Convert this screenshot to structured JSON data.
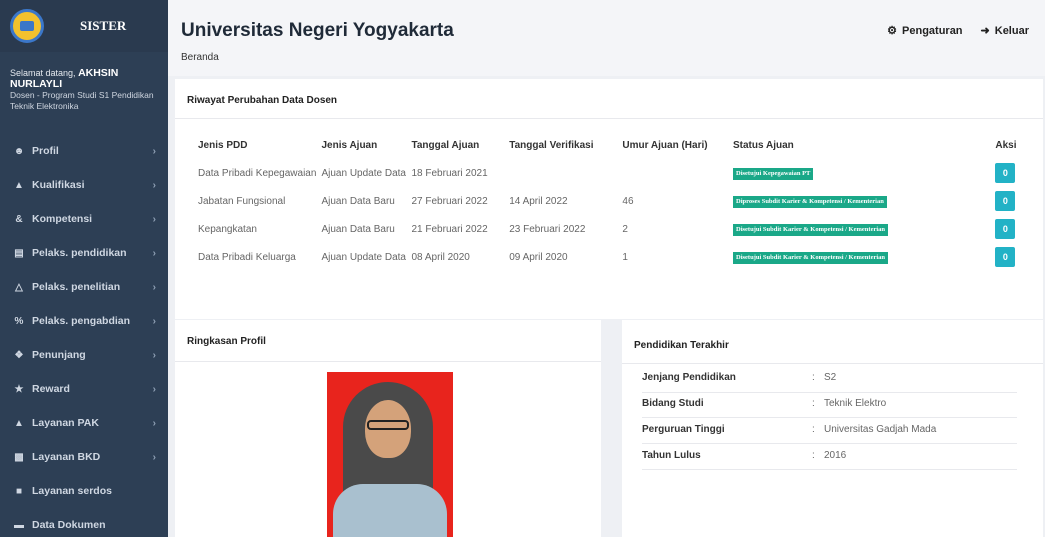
{
  "sidebar": {
    "brand": "SISTER",
    "welcome_prefix": "Selamat datang,",
    "user_name": "AKHSIN NURLAYLI",
    "user_role": "Dosen - Program Studi S1 Pendidikan Teknik Elektronika",
    "items": [
      {
        "label": "Profil",
        "icon": "user-icon"
      },
      {
        "label": "Kualifikasi",
        "icon": "graduation-cap-icon"
      },
      {
        "label": "Kompetensi",
        "icon": "link-icon"
      },
      {
        "label": "Pelaks. pendidikan",
        "icon": "book-icon"
      },
      {
        "label": "Pelaks. penelitian",
        "icon": "flask-icon"
      },
      {
        "label": "Pelaks. pengabdian",
        "icon": "percent-icon"
      },
      {
        "label": "Penunjang",
        "icon": "gift-icon"
      },
      {
        "label": "Reward",
        "icon": "trophy-icon"
      },
      {
        "label": "Layanan PAK",
        "icon": "graduation-cap-icon"
      },
      {
        "label": "Layanan BKD",
        "icon": "briefcase-icon"
      },
      {
        "label": "Layanan serdos",
        "icon": "book-icon"
      },
      {
        "label": "Data Dokumen",
        "icon": "folder-icon"
      }
    ]
  },
  "header": {
    "title": "Universitas Negeri Yogyakarta",
    "breadcrumb": "Beranda",
    "settings_label": "Pengaturan",
    "logout_label": "Keluar"
  },
  "riwayat": {
    "title": "Riwayat Perubahan Data Dosen",
    "columns": [
      "Jenis PDD",
      "Jenis Ajuan",
      "Tanggal Ajuan",
      "Tanggal Verifikasi",
      "Umur Ajuan (Hari)",
      "Status Ajuan",
      "Aksi"
    ],
    "rows": [
      {
        "jenis_pdd": "Data Pribadi Kepegawaian",
        "jenis_ajuan": "Ajuan Update Data",
        "tgl_ajuan": "18 Februari 2021",
        "tgl_verif": "",
        "umur": "",
        "status": "Disetujui Kepegawaian PT",
        "aksi": "0"
      },
      {
        "jenis_pdd": "Jabatan Fungsional",
        "jenis_ajuan": "Ajuan Data Baru",
        "tgl_ajuan": "27 Februari 2022",
        "tgl_verif": "14 April 2022",
        "umur": "46",
        "status": "Diproses Subdit Karier & Kompetensi / Kementerian",
        "aksi": "0"
      },
      {
        "jenis_pdd": "Kepangkatan",
        "jenis_ajuan": "Ajuan Data Baru",
        "tgl_ajuan": "21 Februari 2022",
        "tgl_verif": "23 Februari 2022",
        "umur": "2",
        "status": "Disetujui Subdit Karier & Kompetensi / Kementerian",
        "aksi": "0"
      },
      {
        "jenis_pdd": "Data Pribadi Keluarga",
        "jenis_ajuan": "Ajuan Update Data",
        "tgl_ajuan": "08 April 2020",
        "tgl_verif": "09 April 2020",
        "umur": "1",
        "status": "Disetujui Subdit Karier & Kompetensi / Kementerian",
        "aksi": "0"
      }
    ]
  },
  "ringkasan": {
    "title": "Ringkasan Profil"
  },
  "pendidikan": {
    "title": "Pendidikan Terakhir",
    "rows": [
      {
        "key": "Jenjang Pendidikan",
        "value": "S2"
      },
      {
        "key": "Bidang Studi",
        "value": "Teknik Elektro"
      },
      {
        "key": "Perguruan Tinggi",
        "value": "Universitas Gadjah Mada"
      },
      {
        "key": "Tahun Lulus",
        "value": "2016"
      }
    ]
  },
  "colors": {
    "sidebar_bg": "#2d3f55",
    "status_green": "#1aa888",
    "action_teal": "#22b2c6"
  }
}
